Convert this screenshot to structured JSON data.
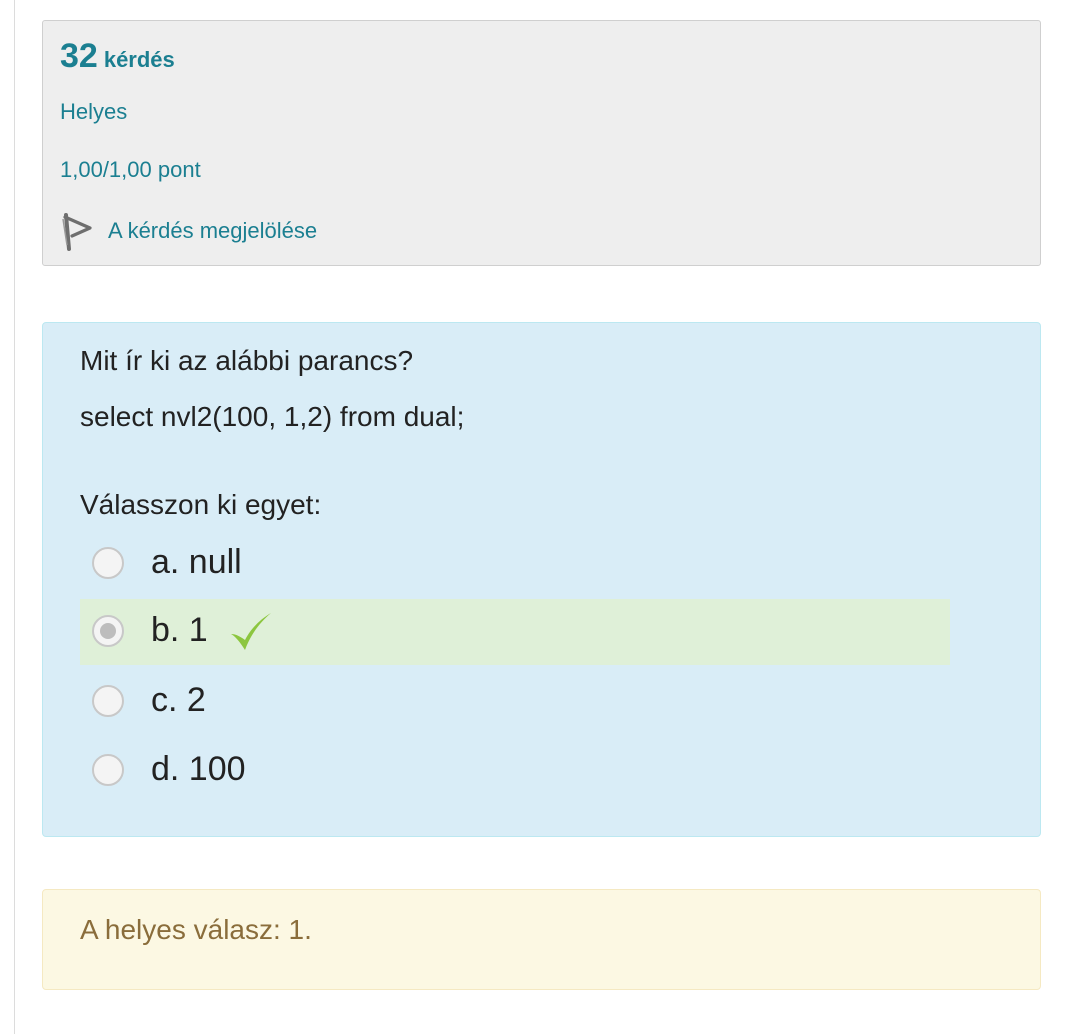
{
  "info": {
    "question_number": "32",
    "question_word": "kérdés",
    "state": "Helyes",
    "grade": "1,00/1,00 pont",
    "flag_label": "A kérdés megjelölése",
    "flag_icon": "flag-icon"
  },
  "question": {
    "line1": "Mit ír ki az alábbi parancs?",
    "line2": "select nvl2(100, 1,2) from dual;",
    "prompt": "Válasszon ki egyet:",
    "options": [
      {
        "label": "a. null",
        "selected": false,
        "correct": false
      },
      {
        "label": "b. 1",
        "selected": true,
        "correct": true
      },
      {
        "label": "c. 2",
        "selected": false,
        "correct": false
      },
      {
        "label": "d. 100",
        "selected": false,
        "correct": false
      }
    ],
    "correct_icon": "checkmark-icon"
  },
  "feedback": {
    "right_answer": "A helyes válasz: 1."
  },
  "colors": {
    "link": "#1b7f91",
    "question_bg": "#d9edf7",
    "correct_bg": "#dff0d8",
    "tick": "#8cc63f",
    "feedback_bg": "#fcf8e3",
    "feedback_text": "#8a6d3b"
  }
}
